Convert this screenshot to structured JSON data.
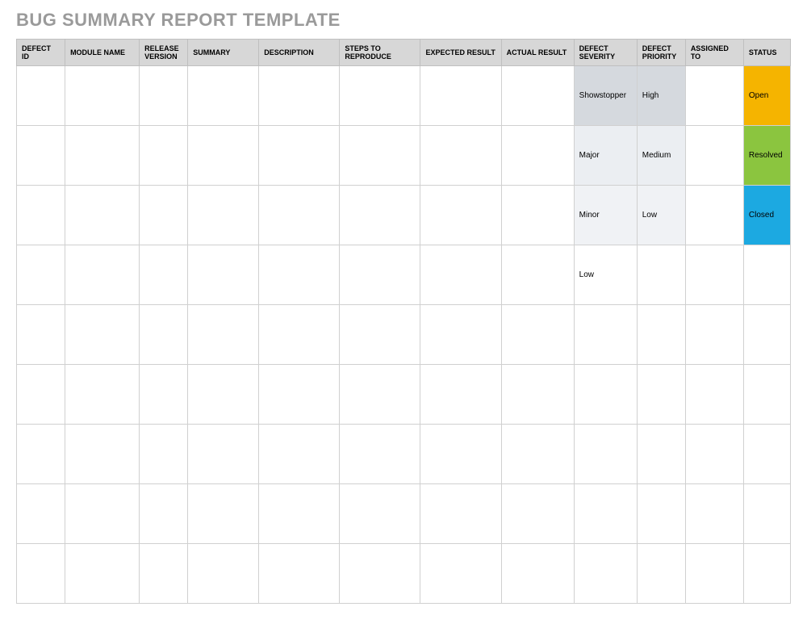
{
  "title": "BUG SUMMARY REPORT TEMPLATE",
  "headers": [
    "DEFECT ID",
    "MODULE NAME",
    "RELEASE VERSION",
    "SUMMARY",
    "DESCRIPTION",
    "STEPS TO REPRODUCE",
    "EXPECTED RESULT",
    "ACTUAL RESULT",
    "DEFECT SEVERITY",
    "DEFECT PRIORITY",
    "ASSIGNED TO",
    "STATUS"
  ],
  "rows": [
    {
      "defect_id": "",
      "module_name": "",
      "release_version": "",
      "summary": "",
      "description": "",
      "steps": "",
      "expected": "",
      "actual": "",
      "severity": "Showstopper",
      "severity_bg": "bg-gray-blue",
      "priority": "High",
      "priority_bg": "bg-gray-blue",
      "assigned": "",
      "status": "Open",
      "status_bg": "bg-yellow"
    },
    {
      "defect_id": "",
      "module_name": "",
      "release_version": "",
      "summary": "",
      "description": "",
      "steps": "",
      "expected": "",
      "actual": "",
      "severity": "Major",
      "severity_bg": "bg-light-gray-blue",
      "priority": "Medium",
      "priority_bg": "bg-light-gray-blue",
      "assigned": "",
      "status": "Resolved",
      "status_bg": "bg-green"
    },
    {
      "defect_id": "",
      "module_name": "",
      "release_version": "",
      "summary": "",
      "description": "",
      "steps": "",
      "expected": "",
      "actual": "",
      "severity": "Minor",
      "severity_bg": "bg-lighter-gray-blue",
      "priority": "Low",
      "priority_bg": "bg-lighter-gray-blue",
      "assigned": "",
      "status": "Closed",
      "status_bg": "bg-blue"
    },
    {
      "defect_id": "",
      "module_name": "",
      "release_version": "",
      "summary": "",
      "description": "",
      "steps": "",
      "expected": "",
      "actual": "",
      "severity": "Low",
      "severity_bg": "",
      "priority": "",
      "priority_bg": "",
      "assigned": "",
      "status": "",
      "status_bg": ""
    },
    {
      "defect_id": "",
      "module_name": "",
      "release_version": "",
      "summary": "",
      "description": "",
      "steps": "",
      "expected": "",
      "actual": "",
      "severity": "",
      "severity_bg": "",
      "priority": "",
      "priority_bg": "",
      "assigned": "",
      "status": "",
      "status_bg": ""
    },
    {
      "defect_id": "",
      "module_name": "",
      "release_version": "",
      "summary": "",
      "description": "",
      "steps": "",
      "expected": "",
      "actual": "",
      "severity": "",
      "severity_bg": "",
      "priority": "",
      "priority_bg": "",
      "assigned": "",
      "status": "",
      "status_bg": ""
    },
    {
      "defect_id": "",
      "module_name": "",
      "release_version": "",
      "summary": "",
      "description": "",
      "steps": "",
      "expected": "",
      "actual": "",
      "severity": "",
      "severity_bg": "",
      "priority": "",
      "priority_bg": "",
      "assigned": "",
      "status": "",
      "status_bg": ""
    },
    {
      "defect_id": "",
      "module_name": "",
      "release_version": "",
      "summary": "",
      "description": "",
      "steps": "",
      "expected": "",
      "actual": "",
      "severity": "",
      "severity_bg": "",
      "priority": "",
      "priority_bg": "",
      "assigned": "",
      "status": "",
      "status_bg": ""
    },
    {
      "defect_id": "",
      "module_name": "",
      "release_version": "",
      "summary": "",
      "description": "",
      "steps": "",
      "expected": "",
      "actual": "",
      "severity": "",
      "severity_bg": "",
      "priority": "",
      "priority_bg": "",
      "assigned": "",
      "status": "",
      "status_bg": ""
    }
  ]
}
